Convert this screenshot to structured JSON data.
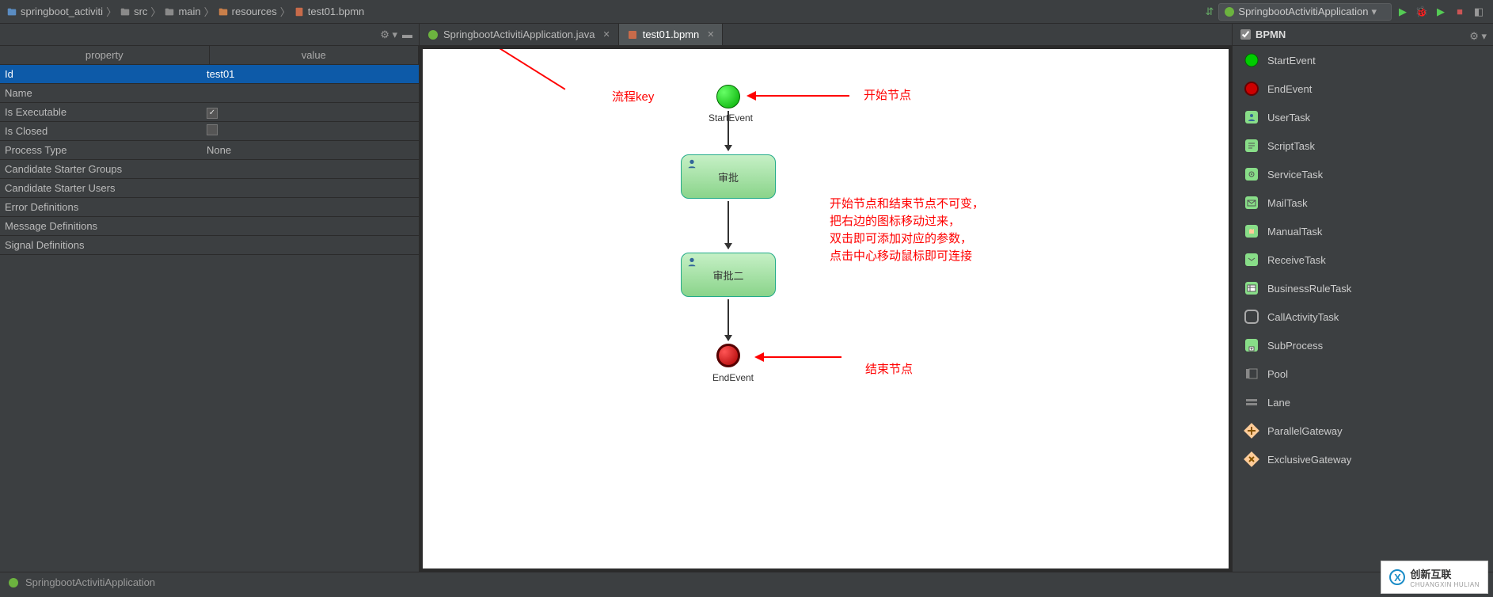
{
  "breadcrumb": [
    {
      "icon": "module",
      "label": "springboot_activiti"
    },
    {
      "icon": "folder",
      "label": "src"
    },
    {
      "icon": "folder",
      "label": "main"
    },
    {
      "icon": "resources",
      "label": "resources"
    },
    {
      "icon": "bpmn",
      "label": "test01.bpmn"
    }
  ],
  "run_config": "SpringbootActivitiApplication",
  "properties": {
    "header_prop": "property",
    "header_val": "value",
    "rows": [
      {
        "name": "Id",
        "value": "test01",
        "selected": true
      },
      {
        "name": "Name",
        "value": ""
      },
      {
        "name": "Is Executable",
        "value_type": "checkbox",
        "checked": true
      },
      {
        "name": "Is Closed",
        "value_type": "checkbox",
        "checked": false
      },
      {
        "name": "Process Type",
        "value": "None"
      },
      {
        "name": "Candidate Starter Groups",
        "value": ""
      },
      {
        "name": "Candidate Starter Users",
        "value": ""
      },
      {
        "name": "Error Definitions",
        "value": ""
      },
      {
        "name": "Message Definitions",
        "value": ""
      },
      {
        "name": "Signal Definitions",
        "value": ""
      }
    ]
  },
  "tabs": [
    {
      "icon": "java",
      "label": "SpringbootActivitiApplication.java",
      "active": false
    },
    {
      "icon": "bpmn",
      "label": "test01.bpmn",
      "active": true
    }
  ],
  "diagram": {
    "start_label": "StartEvent",
    "end_label": "EndEvent",
    "task1": "审批",
    "task2": "审批二"
  },
  "annotations": {
    "key_note": "流程key",
    "start_note": "开始节点",
    "end_note": "结束节点",
    "help_lines": "开始节点和结束节点不可变，\n把右边的图标移动过来，\n双击即可添加对应的参数，\n点击中心移动鼠标即可连接"
  },
  "palette": {
    "header": "BPMN",
    "items": [
      {
        "name": "StartEvent",
        "icon": "start"
      },
      {
        "name": "EndEvent",
        "icon": "end"
      },
      {
        "name": "UserTask",
        "icon": "user"
      },
      {
        "name": "ScriptTask",
        "icon": "script"
      },
      {
        "name": "ServiceTask",
        "icon": "service"
      },
      {
        "name": "MailTask",
        "icon": "mail"
      },
      {
        "name": "ManualTask",
        "icon": "manual"
      },
      {
        "name": "ReceiveTask",
        "icon": "receive"
      },
      {
        "name": "BusinessRuleTask",
        "icon": "rule"
      },
      {
        "name": "CallActivityTask",
        "icon": "call"
      },
      {
        "name": "SubProcess",
        "icon": "sub"
      },
      {
        "name": "Pool",
        "icon": "pool"
      },
      {
        "name": "Lane",
        "icon": "lane"
      },
      {
        "name": "ParallelGateway",
        "icon": "parallel"
      },
      {
        "name": "ExclusiveGateway",
        "icon": "exclusive"
      }
    ]
  },
  "watermark": {
    "brand": "创新互联",
    "sub": "CHUANGXIN HULIAN"
  },
  "status": "SpringbootActivitiApplication"
}
